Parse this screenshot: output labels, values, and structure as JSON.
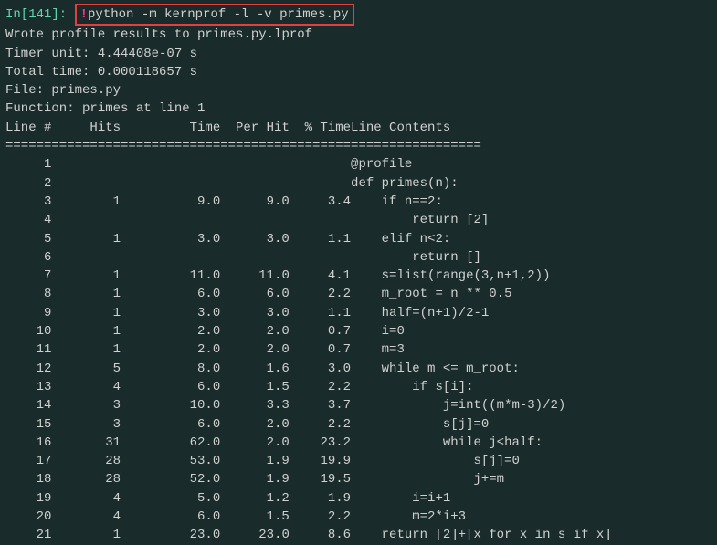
{
  "prompt": {
    "label": "In[141]: ",
    "bang": "!",
    "command": "python -m kernprof -l -v primes.py"
  },
  "output": {
    "line1": "Wrote profile results to primes.py.lprof",
    "line2": "Timer unit: 4.44408e-07 s",
    "blank1": "",
    "line3": "Total time: 0.000118657 s",
    "line4": "File: primes.py",
    "line5": "Function: primes at line 1",
    "blank2": ""
  },
  "headers": {
    "linenum": "Line #",
    "hits": "Hits",
    "time": "Time",
    "perhit": "Per Hit",
    "pct": "% Time",
    "content": "Line Contents"
  },
  "divider": "==============================================================",
  "chart_data": {
    "type": "table",
    "title": "Line profiler output for primes.py",
    "columns": [
      "Line #",
      "Hits",
      "Time",
      "Per Hit",
      "% Time",
      "Line Contents"
    ],
    "rows": [
      {
        "line": 1,
        "hits": null,
        "time": null,
        "perhit": null,
        "pct": null,
        "content": "@profile"
      },
      {
        "line": 2,
        "hits": null,
        "time": null,
        "perhit": null,
        "pct": null,
        "content": "def primes(n):"
      },
      {
        "line": 3,
        "hits": 1,
        "time": 9.0,
        "perhit": 9.0,
        "pct": 3.4,
        "content": "    if n==2:"
      },
      {
        "line": 4,
        "hits": null,
        "time": null,
        "perhit": null,
        "pct": null,
        "content": "        return [2]"
      },
      {
        "line": 5,
        "hits": 1,
        "time": 3.0,
        "perhit": 3.0,
        "pct": 1.1,
        "content": "    elif n<2:"
      },
      {
        "line": 6,
        "hits": null,
        "time": null,
        "perhit": null,
        "pct": null,
        "content": "        return []"
      },
      {
        "line": 7,
        "hits": 1,
        "time": 11.0,
        "perhit": 11.0,
        "pct": 4.1,
        "content": "    s=list(range(3,n+1,2))"
      },
      {
        "line": 8,
        "hits": 1,
        "time": 6.0,
        "perhit": 6.0,
        "pct": 2.2,
        "content": "    m_root = n ** 0.5"
      },
      {
        "line": 9,
        "hits": 1,
        "time": 3.0,
        "perhit": 3.0,
        "pct": 1.1,
        "content": "    half=(n+1)/2-1"
      },
      {
        "line": 10,
        "hits": 1,
        "time": 2.0,
        "perhit": 2.0,
        "pct": 0.7,
        "content": "    i=0"
      },
      {
        "line": 11,
        "hits": 1,
        "time": 2.0,
        "perhit": 2.0,
        "pct": 0.7,
        "content": "    m=3"
      },
      {
        "line": 12,
        "hits": 5,
        "time": 8.0,
        "perhit": 1.6,
        "pct": 3.0,
        "content": "    while m <= m_root:"
      },
      {
        "line": 13,
        "hits": 4,
        "time": 6.0,
        "perhit": 1.5,
        "pct": 2.2,
        "content": "        if s[i]:"
      },
      {
        "line": 14,
        "hits": 3,
        "time": 10.0,
        "perhit": 3.3,
        "pct": 3.7,
        "content": "            j=int((m*m-3)/2)"
      },
      {
        "line": 15,
        "hits": 3,
        "time": 6.0,
        "perhit": 2.0,
        "pct": 2.2,
        "content": "            s[j]=0"
      },
      {
        "line": 16,
        "hits": 31,
        "time": 62.0,
        "perhit": 2.0,
        "pct": 23.2,
        "content": "            while j<half:"
      },
      {
        "line": 17,
        "hits": 28,
        "time": 53.0,
        "perhit": 1.9,
        "pct": 19.9,
        "content": "                s[j]=0"
      },
      {
        "line": 18,
        "hits": 28,
        "time": 52.0,
        "perhit": 1.9,
        "pct": 19.5,
        "content": "                j+=m"
      },
      {
        "line": 19,
        "hits": 4,
        "time": 5.0,
        "perhit": 1.2,
        "pct": 1.9,
        "content": "        i=i+1"
      },
      {
        "line": 20,
        "hits": 4,
        "time": 6.0,
        "perhit": 1.5,
        "pct": 2.2,
        "content": "        m=2*i+3"
      },
      {
        "line": 21,
        "hits": 1,
        "time": 23.0,
        "perhit": 23.0,
        "pct": 8.6,
        "content": "    return [2]+[x for x in s if x]"
      }
    ]
  }
}
